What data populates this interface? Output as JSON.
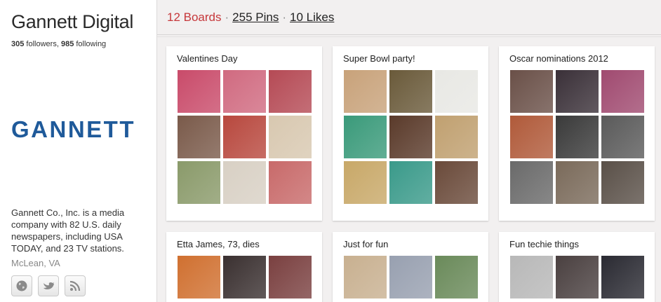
{
  "profile": {
    "name": "Gannett Digital",
    "followers_count": "305",
    "followers_label": "followers,",
    "following_count": "985",
    "following_label": "following",
    "logo_text": "GANNETT",
    "bio": "Gannett Co., Inc. is a media company with 82 U.S. daily newspapers, including USA TODAY, and 23 TV stations.",
    "location": "McLean, VA",
    "social_icons": [
      "globe-icon",
      "twitter-bird-icon",
      "rss-icon"
    ]
  },
  "counts": {
    "boards": "12 Boards",
    "pins": "255 Pins",
    "likes": "10 Likes",
    "separator": "·"
  },
  "colors": {
    "boards_accent": "#c6373a",
    "logo": "#1f5a9a",
    "background": "#f2f0f0"
  },
  "boards": [
    {
      "title": "Valentines Day",
      "thumbs": [
        "#c94b6a",
        "#d06a80",
        "#b54a55",
        "#7a5a4a",
        "#b8483e",
        "#d8c8b0",
        "#8a9a6a",
        "#d8d0c4",
        "#c86a6a"
      ]
    },
    {
      "title": "Super Bowl party!",
      "thumbs": [
        "#c8a27a",
        "#6a5a3a",
        "#e8e8e4",
        "#3a9a7a",
        "#5a3a2a",
        "#c0a070",
        "#c8a868",
        "#3a9a8a",
        "#6a4a3a"
      ]
    },
    {
      "title": "Oscar nominations 2012",
      "thumbs": [
        "#6a5048",
        "#3a3038",
        "#a04a70",
        "#b05a3a",
        "#3a3a3a",
        "#5a5a5a",
        "#6a6a6a",
        "#7a6a5a",
        "#5a5048"
      ]
    },
    {
      "title": "Etta James, 73, dies",
      "thumbs": [
        "#d07030",
        "#3a3030",
        "#7a4040"
      ]
    },
    {
      "title": "Just for fun",
      "thumbs": [
        "#c8b090",
        "#98a0b0",
        "#6a8a5a"
      ]
    },
    {
      "title": "Fun techie things",
      "thumbs": [
        "#b8b8b8",
        "#4a4040",
        "#2a2a32"
      ]
    }
  ]
}
